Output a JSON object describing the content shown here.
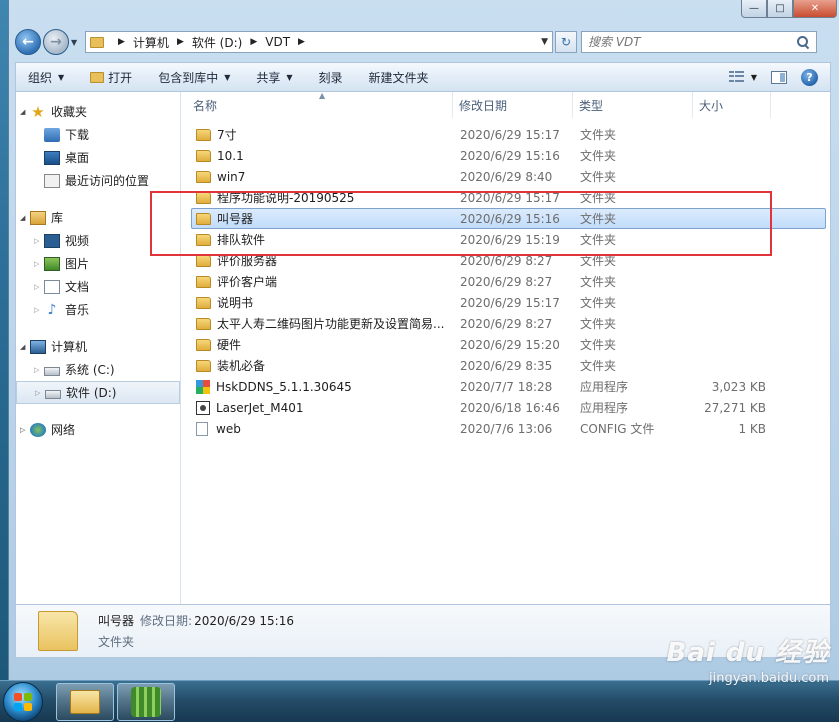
{
  "window": {
    "caption": {
      "minimize": "—",
      "maximize": "□",
      "close": "✕"
    }
  },
  "address": {
    "crumbs": [
      "计算机",
      "软件 (D:)",
      "VDT"
    ],
    "search_placeholder": "搜索 VDT"
  },
  "toolbar": {
    "organize": "组织",
    "open": "打开",
    "include_in_library": "包含到库中",
    "share": "共享",
    "burn": "刻录",
    "new_folder": "新建文件夹",
    "help": "?"
  },
  "nav": {
    "favorites": {
      "label": "收藏夹",
      "items": [
        "下载",
        "桌面",
        "最近访问的位置"
      ]
    },
    "libraries": {
      "label": "库",
      "items": [
        "视频",
        "图片",
        "文档",
        "音乐"
      ]
    },
    "computer": {
      "label": "计算机",
      "items": [
        "系统 (C:)",
        "软件 (D:)"
      ]
    },
    "network": {
      "label": "网络"
    }
  },
  "columns": {
    "name": "名称",
    "date": "修改日期",
    "type": "类型",
    "size": "大小"
  },
  "files": [
    {
      "name": "7寸",
      "date": "2020/6/29 15:17",
      "type": "文件夹",
      "size": "",
      "icon": "folder-icon"
    },
    {
      "name": "10.1",
      "date": "2020/6/29 15:16",
      "type": "文件夹",
      "size": "",
      "icon": "folder-icon"
    },
    {
      "name": "win7",
      "date": "2020/6/29 8:40",
      "type": "文件夹",
      "size": "",
      "icon": "folder-icon"
    },
    {
      "name": "程序功能说明-20190525",
      "date": "2020/6/29 15:17",
      "type": "文件夹",
      "size": "",
      "icon": "folder-icon"
    },
    {
      "name": "叫号器",
      "date": "2020/6/29 15:16",
      "type": "文件夹",
      "size": "",
      "icon": "folder-icon"
    },
    {
      "name": "排队软件",
      "date": "2020/6/29 15:19",
      "type": "文件夹",
      "size": "",
      "icon": "folder-icon"
    },
    {
      "name": "评价服务器",
      "date": "2020/6/29 8:27",
      "type": "文件夹",
      "size": "",
      "icon": "folder-icon"
    },
    {
      "name": "评价客户端",
      "date": "2020/6/29 8:27",
      "type": "文件夹",
      "size": "",
      "icon": "folder-icon"
    },
    {
      "name": "说明书",
      "date": "2020/6/29 15:17",
      "type": "文件夹",
      "size": "",
      "icon": "folder-icon"
    },
    {
      "name": "太平人寿二维码图片功能更新及设置简易...",
      "date": "2020/6/29 8:27",
      "type": "文件夹",
      "size": "",
      "icon": "folder-icon"
    },
    {
      "name": "硬件",
      "date": "2020/6/29 15:20",
      "type": "文件夹",
      "size": "",
      "icon": "folder-icon"
    },
    {
      "name": "装机必备",
      "date": "2020/6/29 8:35",
      "type": "文件夹",
      "size": "",
      "icon": "folder-icon"
    },
    {
      "name": "HskDDNS_5.1.1.30645",
      "date": "2020/7/7 18:28",
      "type": "应用程序",
      "size": "3,023 KB",
      "icon": "app-icon"
    },
    {
      "name": "LaserJet_M401",
      "date": "2020/6/18 16:46",
      "type": "应用程序",
      "size": "27,271 KB",
      "icon": "printer-app-icon"
    },
    {
      "name": "web",
      "date": "2020/7/6 13:06",
      "type": "CONFIG 文件",
      "size": "1 KB",
      "icon": "config-icon"
    }
  ],
  "selected_index": 4,
  "details": {
    "name": "叫号器",
    "date_label": "修改日期:",
    "date": "2020/6/29 15:16",
    "type": "文件夹"
  },
  "watermark": {
    "logo": "Bai du 经验",
    "url": "jingyan.baidu.com"
  },
  "colors": {
    "highlight_box": "#e0333a",
    "selection": "#c1dcfb"
  }
}
